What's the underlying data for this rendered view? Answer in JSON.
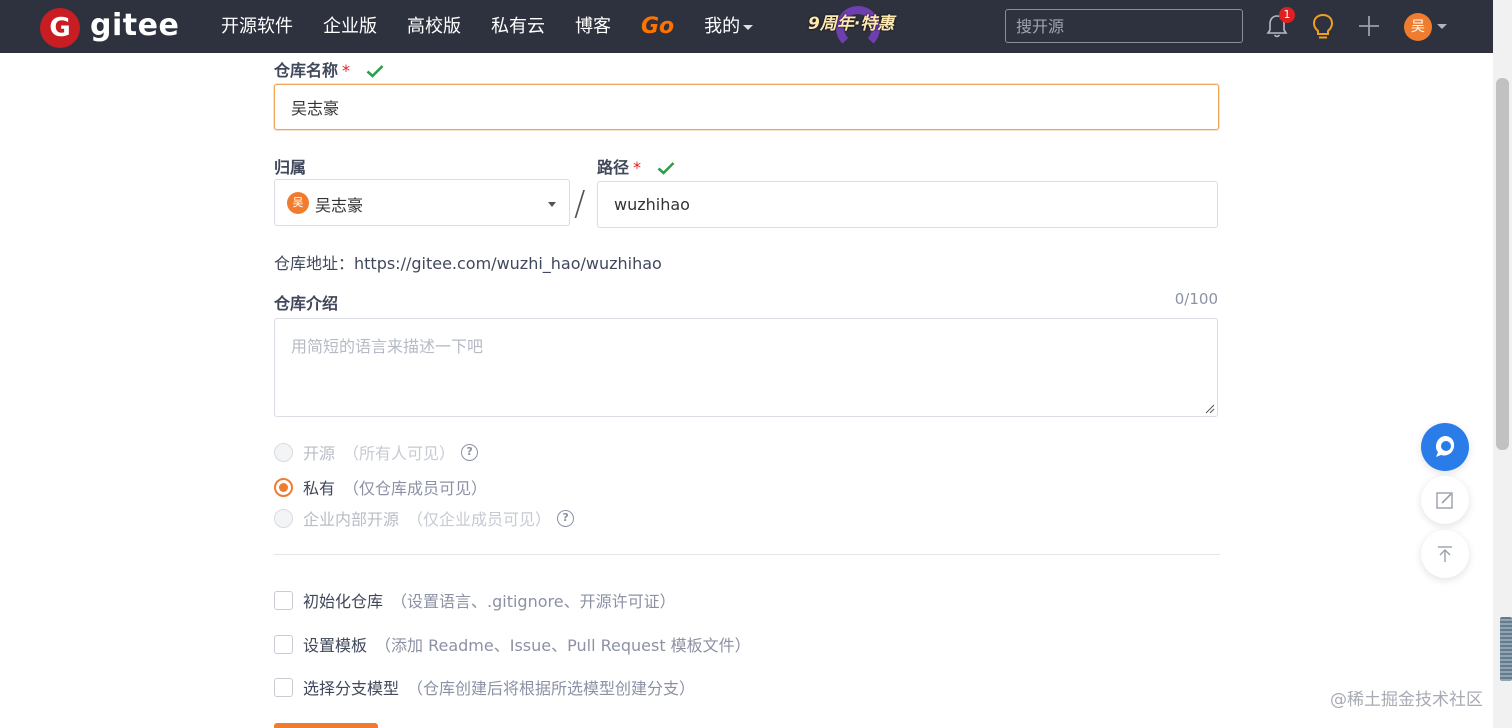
{
  "topbar": {
    "logo_badge": "G",
    "logo_text": "gitee",
    "nav": [
      "开源软件",
      "企业版",
      "高校版",
      "私有云",
      "博客",
      "Go",
      "我的"
    ],
    "promo_text": "9周年·特惠",
    "search_placeholder": "搜开源",
    "notification_count": "1",
    "user_avatar": "吴"
  },
  "form": {
    "name_label": "仓库名称",
    "required_mark": "*",
    "name_value": "吴志豪",
    "owner_label": "归属",
    "owner_avatar": "吴",
    "owner_value": "吴志豪",
    "slash": "/",
    "path_label": "路径",
    "path_value": "wuzhihao",
    "address_text": "仓库地址：https://gitee.com/wuzhi_hao/wuzhihao",
    "desc_label": "仓库介绍",
    "desc_counter": "0/100",
    "desc_placeholder": "用简短的语言来描述一下吧",
    "visibility": [
      {
        "label": "开源",
        "hint": "（所有人可见）",
        "state": "disabled",
        "selected": false,
        "help": "?"
      },
      {
        "label": "私有",
        "hint": "（仅仓库成员可见）",
        "state": "enabled",
        "selected": true,
        "help": ""
      },
      {
        "label": "企业内部开源",
        "hint": "（仅企业成员可见）",
        "state": "disabled",
        "selected": false,
        "help": "?"
      }
    ],
    "options": [
      {
        "label": "初始化仓库",
        "hint": "（设置语言、.gitignore、开源许可证）",
        "checked": false
      },
      {
        "label": "设置模板",
        "hint": "（添加 Readme、Issue、Pull Request 模板文件）",
        "checked": false
      },
      {
        "label": "选择分支模型",
        "hint": "（仓库创建后将根据所选模型创建分支）",
        "checked": false
      }
    ]
  },
  "watermark": "@稀土掘金技术社区",
  "colors": {
    "accent": "#f07d2f",
    "topbar": "#2d323e",
    "check": "#2aa146",
    "required": "#e02020"
  }
}
